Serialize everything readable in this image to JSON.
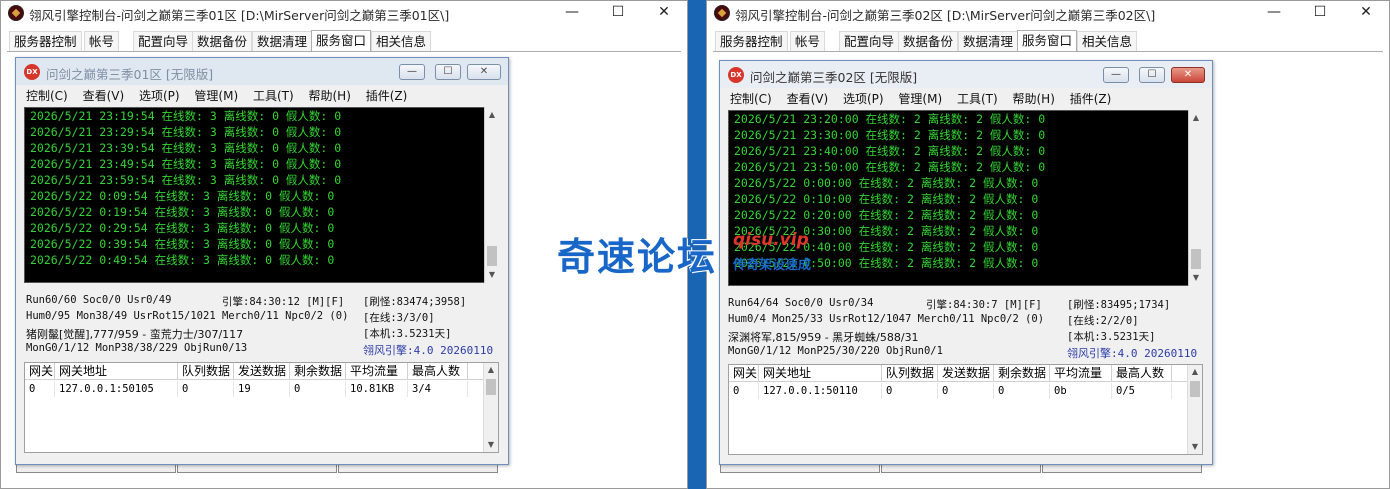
{
  "left_window": {
    "title": "翎风引擎控制台-问剑之巅第三季01区 [D:\\MirServer问剑之巅第三季01区\\]",
    "tabs": [
      "服务器控制",
      "帐号",
      "配置向导",
      "数据备份",
      "数据清理",
      "服务窗口",
      "相关信息"
    ],
    "active_tab": "服务窗口",
    "inner": {
      "title": "问剑之巅第三季01区 [无限版]",
      "menu": [
        "控制(C)",
        "查看(V)",
        "选项(P)",
        "管理(M)",
        "工具(T)",
        "帮助(H)",
        "插件(Z)"
      ],
      "log_lines": [
        "2026/5/21 23:19:54 在线数: 3 离线数: 0 假人数: 0",
        "2026/5/21 23:29:54 在线数: 3 离线数: 0 假人数: 0",
        "2026/5/21 23:39:54 在线数: 3 离线数: 0 假人数: 0",
        "2026/5/21 23:49:54 在线数: 3 离线数: 0 假人数: 0",
        "2026/5/21 23:59:54 在线数: 3 离线数: 0 假人数: 0",
        "2026/5/22 0:09:54 在线数: 3 离线数: 0 假人数: 0",
        "2026/5/22 0:19:54 在线数: 3 离线数: 0 假人数: 0",
        "2026/5/22 0:29:54 在线数: 3 离线数: 0 假人数: 0",
        "2026/5/22 0:39:54 在线数: 3 离线数: 0 假人数: 0",
        "2026/5/22 0:49:54 在线数: 3 离线数: 0 假人数: 0"
      ],
      "stats": {
        "row1_left": "Run60/60 Soc0/0 Usr0/49",
        "row1_mid": "引擎:84:30:12 [M][F]",
        "row1_right": "[刷怪:83474;3958]",
        "row2_left": "Hum0/95 Mon38/49 UsrRot15/1021 Merch0/11 Npc0/2 (0)",
        "row2_right": "[在线:3/3/0]",
        "row3_left": "猪刚鬣[觉醒],777/959 - 蛮荒力士/307/117",
        "row3_right": "[本机:3.5231天]",
        "row4_left": "MonG0/1/12 MonP38/38/229 ObjRun0/13",
        "row4_right": "翎风引擎:4.0 20260110"
      },
      "gate_headers": [
        "网关",
        "网关地址",
        "队列数据",
        "发送数据",
        "剩余数据",
        "平均流量",
        "最高人数"
      ],
      "gate_rows": [
        [
          "0",
          "127.0.0.1:50105",
          "0",
          "19",
          "0",
          "10.81KB",
          "3/4"
        ]
      ]
    }
  },
  "right_window": {
    "title": "翎风引擎控制台-问剑之巅第三季02区 [D:\\MirServer问剑之巅第三季02区\\]",
    "tabs": [
      "服务器控制",
      "帐号",
      "配置向导",
      "数据备份",
      "数据清理",
      "服务窗口",
      "相关信息"
    ],
    "active_tab": "服务窗口",
    "inner": {
      "title": "问剑之巅第三季02区 [无限版]",
      "menu": [
        "控制(C)",
        "查看(V)",
        "选项(P)",
        "管理(M)",
        "工具(T)",
        "帮助(H)",
        "插件(Z)"
      ],
      "log_lines": [
        "2026/5/21 23:20:00 在线数: 2 离线数: 2 假人数: 0",
        "2026/5/21 23:30:00 在线数: 2 离线数: 2 假人数: 0",
        "2026/5/21 23:40:00 在线数: 2 离线数: 2 假人数: 0",
        "2026/5/21 23:50:00 在线数: 2 离线数: 2 假人数: 0",
        "2026/5/22 0:00:00 在线数: 2 离线数: 2 假人数: 0",
        "2026/5/22 0:10:00 在线数: 2 离线数: 2 假人数: 0",
        "2026/5/22 0:20:00 在线数: 2 离线数: 2 假人数: 0",
        "2026/5/22 0:30:00 在线数: 2 离线数: 2 假人数: 0",
        "2026/5/22 0:40:00 在线数: 2 离线数: 2 假人数: 0",
        "2026/5/22 0:50:00 在线数: 2 离线数: 2 假人数: 0"
      ],
      "stats": {
        "row1_left": "Run64/64 Soc0/0 Usr0/34",
        "row1_mid": "引擎:84:30:7 [M][F]",
        "row1_right": "[刷怪:83495;1734]",
        "row2_left": "Hum0/4 Mon25/33 UsrRot12/1047 Merch0/11 Npc0/2 (0)",
        "row2_right": "[在线:2/2/0]",
        "row3_left": "深渊将军,815/959 - 黑牙蜘蛛/588/31",
        "row3_right": "[本机:3.5231天]",
        "row4_left": "MonG0/1/12 MonP25/30/220 ObjRun0/1",
        "row4_right": "翎风引擎:4.0 20260110"
      },
      "gate_headers": [
        "网关",
        "网关地址",
        "队列数据",
        "发送数据",
        "剩余数据",
        "平均流量",
        "最高人数"
      ],
      "gate_rows": [
        [
          "0",
          "127.0.0.1:50110",
          "0",
          "0",
          "0",
          "0b",
          "0/5"
        ]
      ]
    }
  },
  "watermark": {
    "text": "奇速论坛",
    "url": "qisu.vip",
    "slogan": "传奇架设速成"
  },
  "window_controls": {
    "minimize": "—",
    "maximize": "☐",
    "close": "✕"
  },
  "colors": {
    "console_text": "#34d534",
    "console_bg": "#000000",
    "watermark_blue": "#1866c8",
    "watermark_red": "#e0352b"
  }
}
